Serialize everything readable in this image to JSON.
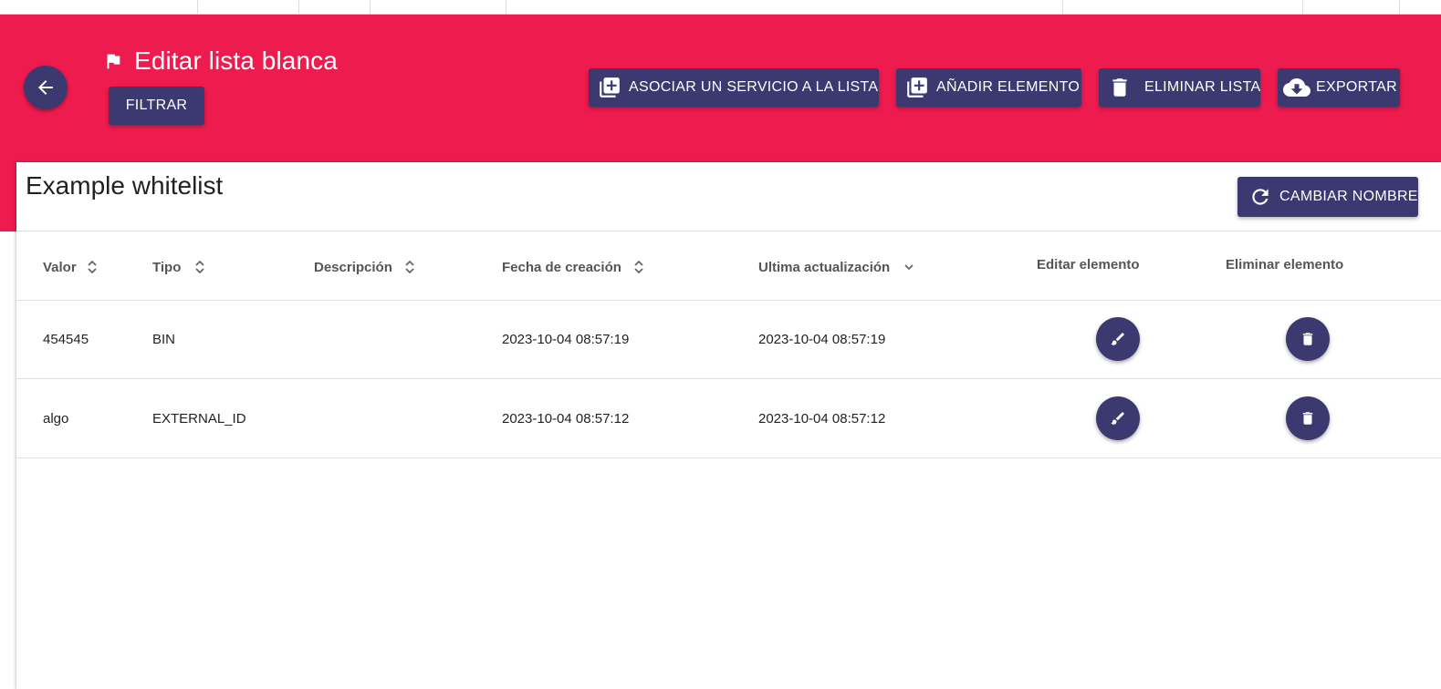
{
  "header": {
    "title": "Editar lista blanca",
    "filter_label": "FILTRAR",
    "actions": {
      "associate_label": "ASOCIAR UN SERVICIO A LA LISTA",
      "add_label": "AÑADIR ELEMENTO",
      "delete_list_label": "ELIMINAR LISTA",
      "export_label": "EXPORTAR"
    },
    "icons": {
      "back": "arrow-left-icon",
      "flag": "flag-icon",
      "associate": "library-add-icon",
      "add": "library-add-icon",
      "delete": "trash-icon",
      "export": "cloud-download-icon"
    }
  },
  "card": {
    "list_name": "Example whitelist",
    "rename_label": "CAMBIAR NOMBRE",
    "rename_icon": "refresh-icon"
  },
  "table": {
    "columns": [
      {
        "label": "Valor",
        "sort": "both"
      },
      {
        "label": "Tipo",
        "sort": "both"
      },
      {
        "label": "Descripción",
        "sort": "both"
      },
      {
        "label": "Fecha de creación",
        "sort": "both"
      },
      {
        "label": "Ultima actualización",
        "sort": "desc"
      },
      {
        "label": "Editar elemento",
        "sort": "none"
      },
      {
        "label": "Eliminar elemento",
        "sort": "none"
      }
    ],
    "rows": [
      {
        "valor": "454545",
        "tipo": "BIN",
        "descripcion": "",
        "fecha_creacion": "2023-10-04 08:57:19",
        "ultima_actualizacion": "2023-10-04 08:57:19"
      },
      {
        "valor": "algo",
        "tipo": "EXTERNAL_ID",
        "descripcion": "",
        "fecha_creacion": "2023-10-04 08:57:12",
        "ultima_actualizacion": "2023-10-04 08:57:12"
      }
    ],
    "row_icons": {
      "edit": "brush-icon",
      "delete": "trash-icon"
    }
  },
  "colors": {
    "header_bg": "#ee1b4e",
    "primary": "#3c3870",
    "text": "#222222",
    "header_text": "#555555"
  }
}
